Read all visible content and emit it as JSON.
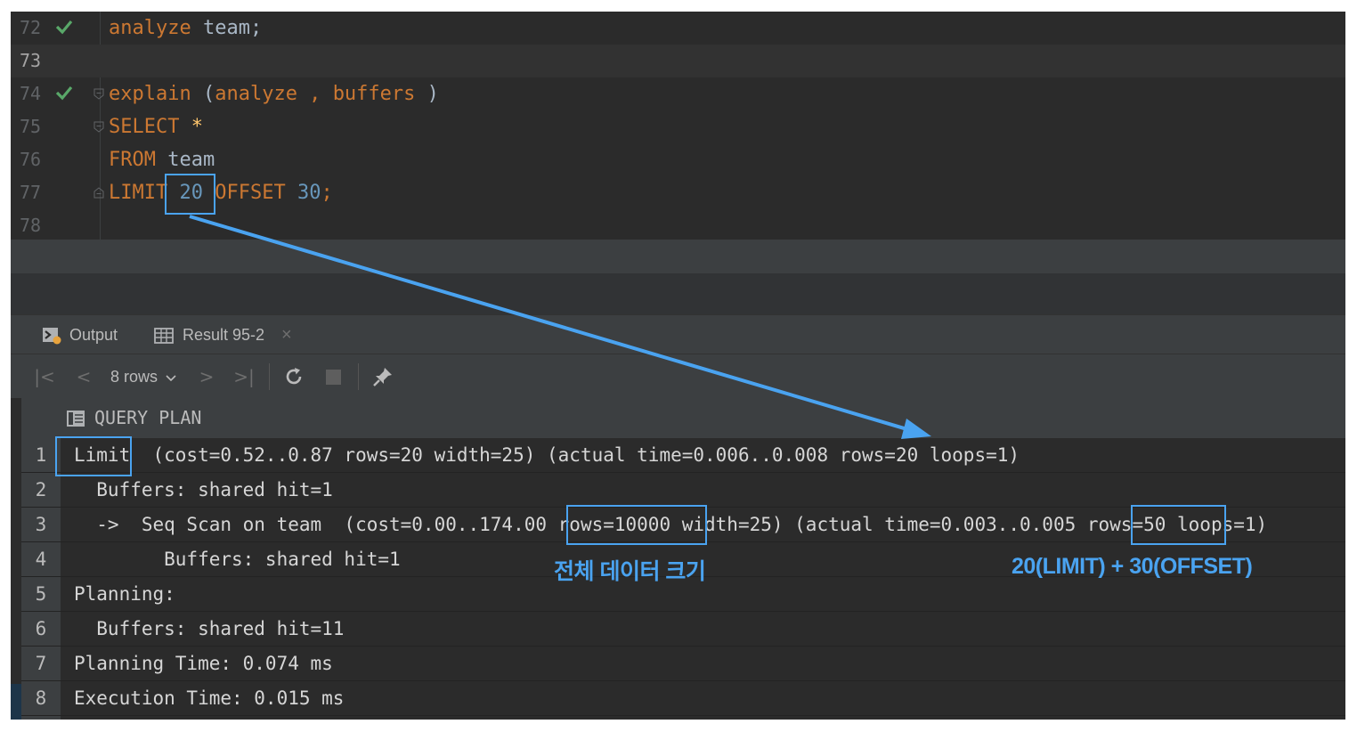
{
  "editor": {
    "lines": [
      {
        "num": "72",
        "code": "analyze team;",
        "status": "check"
      },
      {
        "num": "73",
        "code": ""
      },
      {
        "num": "74",
        "code": "explain (analyze , buffers )",
        "status": "check"
      },
      {
        "num": "75",
        "code": "SELECT *"
      },
      {
        "num": "76",
        "code": "FROM team"
      },
      {
        "num": "77",
        "code": "LIMIT 20 OFFSET 30;"
      },
      {
        "num": "78",
        "code": ""
      }
    ],
    "tokens": {
      "l72_kw": "analyze",
      "l72_rest": " team;",
      "l74_kw1": "explain",
      "l74_p1": " (",
      "l74_kw2": "analyze",
      "l74_comma": " , ",
      "l74_kw3": "buffers",
      "l74_p2": " )",
      "l75_kw": "SELECT",
      "l75_star": " *",
      "l76_kw": "FROM",
      "l76_rest": " team",
      "l77_kw1": "LIMIT",
      "l77_sp1": " ",
      "l77_n1": "20",
      "l77_sp2": " ",
      "l77_kw2": "OFFSET",
      "l77_sp3": " ",
      "l77_n2": "30",
      "l77_semi": ";"
    }
  },
  "tabs": [
    {
      "label": "Output",
      "icon": "console-icon"
    },
    {
      "label": "Result 95-2",
      "icon": "table-icon",
      "close": "×"
    }
  ],
  "toolbar": {
    "first": "|<",
    "prev": "<",
    "rows_label": "8 rows",
    "next": ">",
    "last": ">|",
    "refresh_icon": "refresh-icon",
    "stop_icon": "stop-icon",
    "pin_icon": "pin-icon"
  },
  "grid": {
    "column_header": "QUERY PLAN",
    "rows": [
      {
        "n": "1",
        "text": "Limit  (cost=0.52..0.87 rows=20 width=25) (actual time=0.006..0.008 rows=20 loops=1)"
      },
      {
        "n": "2",
        "text": "  Buffers: shared hit=1"
      },
      {
        "n": "3",
        "text": "  ->  Seq Scan on team  (cost=0.00..174.00 rows=10000 width=25) (actual time=0.003..0.005 rows=50 loops=1)"
      },
      {
        "n": "4",
        "text": "        Buffers: shared hit=1"
      },
      {
        "n": "5",
        "text": "Planning:"
      },
      {
        "n": "6",
        "text": "  Buffers: shared hit=11"
      },
      {
        "n": "7",
        "text": "Planning Time: 0.074 ms"
      },
      {
        "n": "8",
        "text": "Execution Time: 0.015 ms"
      }
    ]
  },
  "annotations": {
    "total_size_note": "전체 데이터 크기",
    "limit_offset_note": "20(LIMIT) + 30(OFFSET)",
    "highlight_color": "#4aa3f0"
  },
  "colors": {
    "keyword": "#cc7832",
    "number": "#6897bb",
    "identifier": "#a9b7c6",
    "check": "#59a869"
  }
}
